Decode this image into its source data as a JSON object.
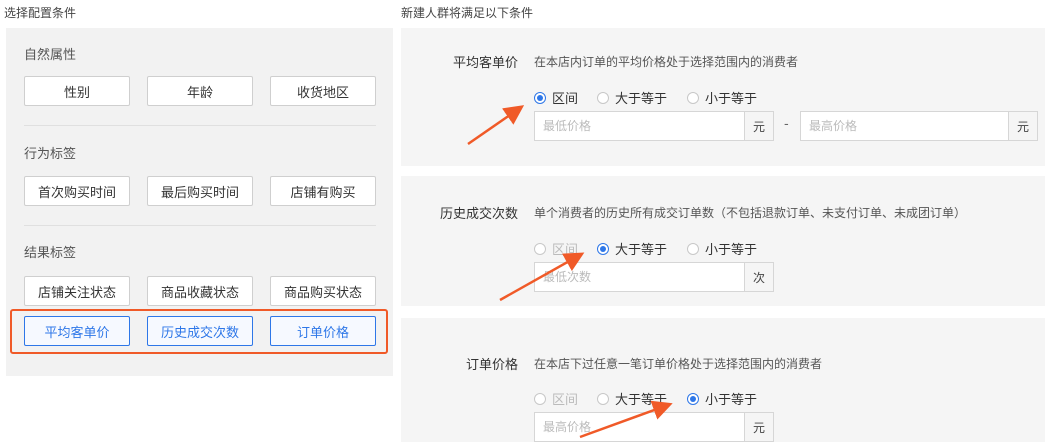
{
  "left": {
    "section_title": "选择配置条件",
    "groups": [
      {
        "title": "自然属性",
        "tags": [
          "性别",
          "年龄",
          "收货地区"
        ]
      },
      {
        "title": "行为标签",
        "tags": [
          "首次购买时间",
          "最后购买时间",
          "店铺有购买"
        ]
      },
      {
        "title": "结果标签",
        "tags": [
          "店铺关注状态",
          "商品收藏状态",
          "商品购买状态"
        ]
      }
    ],
    "active_tags": [
      "平均客单价",
      "历史成交次数",
      "订单价格"
    ]
  },
  "right": {
    "section_title": "新建人群将满足以下条件",
    "radio_labels": [
      "区间",
      "大于等于",
      "小于等于"
    ],
    "conditions": [
      {
        "label": "平均客单价",
        "desc": "在本店内订单的平均价格处于选择范围内的消费者",
        "selected": "区间",
        "min_placeholder": "最低价格",
        "max_placeholder": "最高价格",
        "unit": "元",
        "range_sep": "-"
      },
      {
        "label": "历史成交次数",
        "desc": "单个消费者的历史所有成交订单数（不包括退款订单、未支付订单、未成团订单）",
        "selected": "大于等于",
        "placeholder": "最低次数",
        "unit": "次"
      },
      {
        "label": "订单价格",
        "desc": "在本店下过任意一笔订单价格处于选择范围内的消费者",
        "selected": "小于等于",
        "placeholder": "最高价格",
        "unit": "元"
      }
    ]
  },
  "colors": {
    "accent": "#2e77e8",
    "annotation": "#f05a28",
    "panel_bg": "#f5f5f5"
  }
}
